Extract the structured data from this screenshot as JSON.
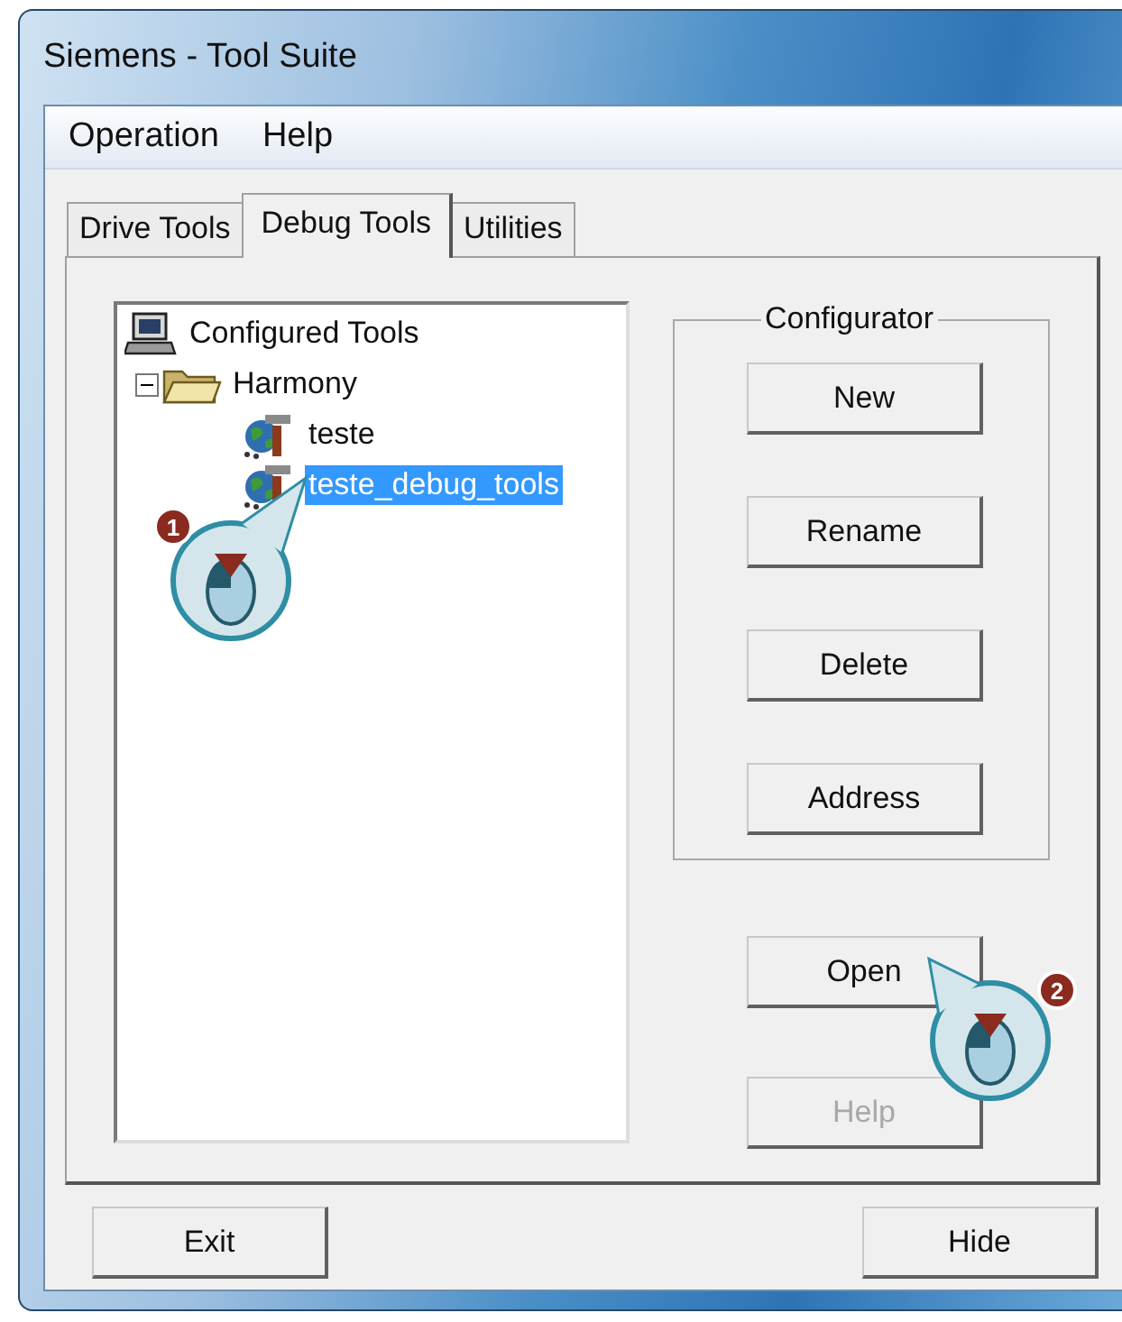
{
  "window": {
    "title": "Siemens - Tool Suite"
  },
  "menu": [
    "Operation",
    "Help"
  ],
  "tabs": [
    {
      "label": "Drive Tools",
      "selected": false
    },
    {
      "label": "Debug Tools",
      "selected": true
    },
    {
      "label": "Utilities",
      "selected": false
    }
  ],
  "tree": [
    {
      "label": "Configured Tools",
      "kind": "computer",
      "selected": false,
      "children": [
        {
          "label": "Harmony",
          "kind": "folder",
          "expanded": true,
          "selected": false,
          "children": [
            {
              "label": "teste",
              "kind": "tool",
              "selected": false
            },
            {
              "label": "teste_debug_tools",
              "kind": "tool",
              "selected": true,
              "callout": "1"
            }
          ]
        }
      ]
    }
  ],
  "configurator": {
    "title": "Configurator",
    "buttons": [
      {
        "label": "New",
        "disabled": false
      },
      {
        "label": "Rename",
        "disabled": false
      },
      {
        "label": "Delete",
        "disabled": false
      },
      {
        "label": "Address",
        "disabled": false
      }
    ]
  },
  "side_buttons": [
    {
      "label": "Open",
      "disabled": false,
      "callout": "2"
    },
    {
      "label": "Help",
      "disabled": true
    }
  ],
  "footer_buttons": [
    {
      "label": "Exit",
      "disabled": false
    },
    {
      "label": "Hide",
      "disabled": false
    }
  ]
}
